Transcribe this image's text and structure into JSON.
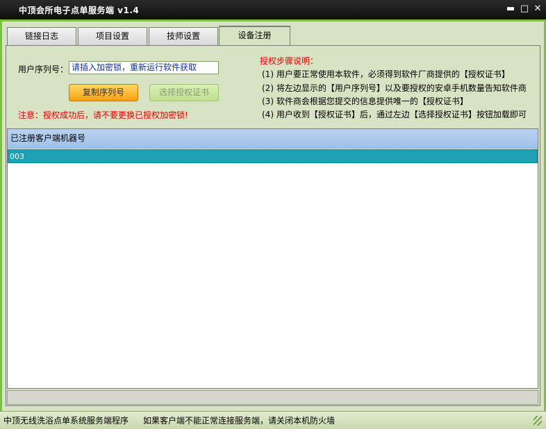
{
  "window": {
    "title": "中顶会所电子点单服务端 v1.4",
    "min_glyph": "▬",
    "max_glyph": "□",
    "close_glyph": "✕"
  },
  "tabs": [
    {
      "label": "链接日志",
      "active": false
    },
    {
      "label": "项目设置",
      "active": false
    },
    {
      "label": "技师设置",
      "active": false
    },
    {
      "label": "设备注册",
      "active": true
    }
  ],
  "registration": {
    "serial_label": "用户序列号：",
    "serial_value": "请插入加密锁，重新运行软件获取",
    "copy_button": "复制序列号",
    "select_button": "选择授权证书",
    "warning": "注意：授权成功后，请不要更换已授权加密锁!"
  },
  "instructions": {
    "title": "授权步骤说明：",
    "steps": [
      "(1) 用户要正常使用本软件，必须得到软件厂商提供的【授权证书】",
      "(2) 将左边显示的【用户序列号】以及要授权的安卓手机数量告知软件商",
      "(3) 软件商会根据您提交的信息提供唯一的【授权证书】",
      "(4) 用户收到【授权证书】后，通过左边【选择授权证书】按钮加载即可"
    ]
  },
  "client_list": {
    "header": "已注册客户端机器号",
    "rows": [
      "003"
    ]
  },
  "statusbar": {
    "left": "中顶无线洗浴点单系统服务端程序",
    "right": "如果客户端不能正常连接服务端，请关闭本机防火墙"
  },
  "colors": {
    "accent_green": "#7cc04a",
    "warning_red": "#e20000",
    "selected_row": "#1ea0b5"
  }
}
